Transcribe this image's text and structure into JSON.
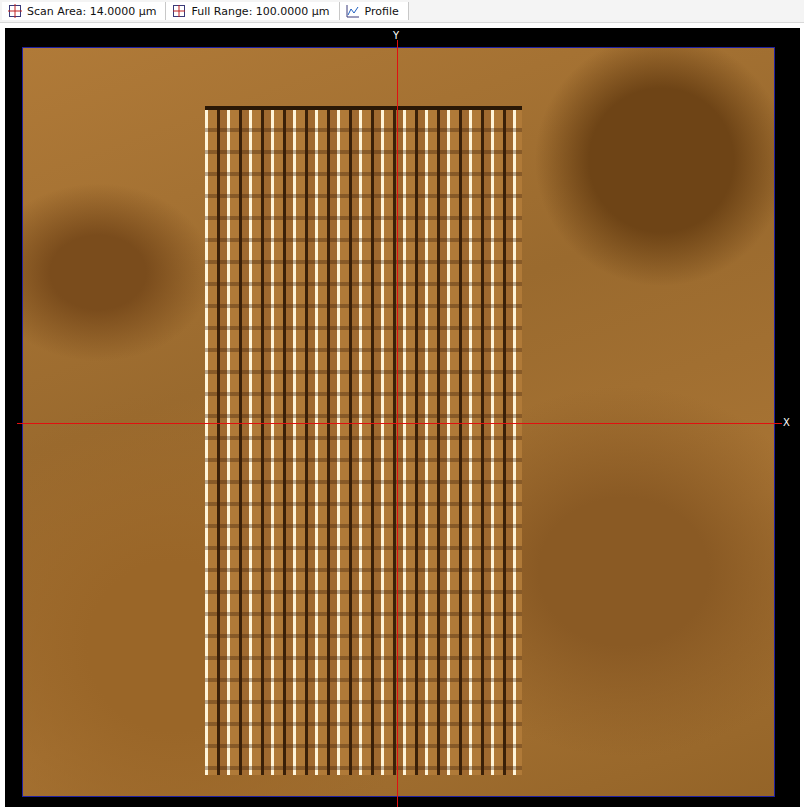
{
  "toolbar": [
    {
      "label": "Scan Area: 14.0000 µm",
      "kind": "scan"
    },
    {
      "label": "Full Range: 100.0000 µm",
      "kind": "range"
    },
    {
      "label": "Profile",
      "kind": "profile"
    }
  ],
  "axes": {
    "x": "X",
    "y": "Y"
  }
}
